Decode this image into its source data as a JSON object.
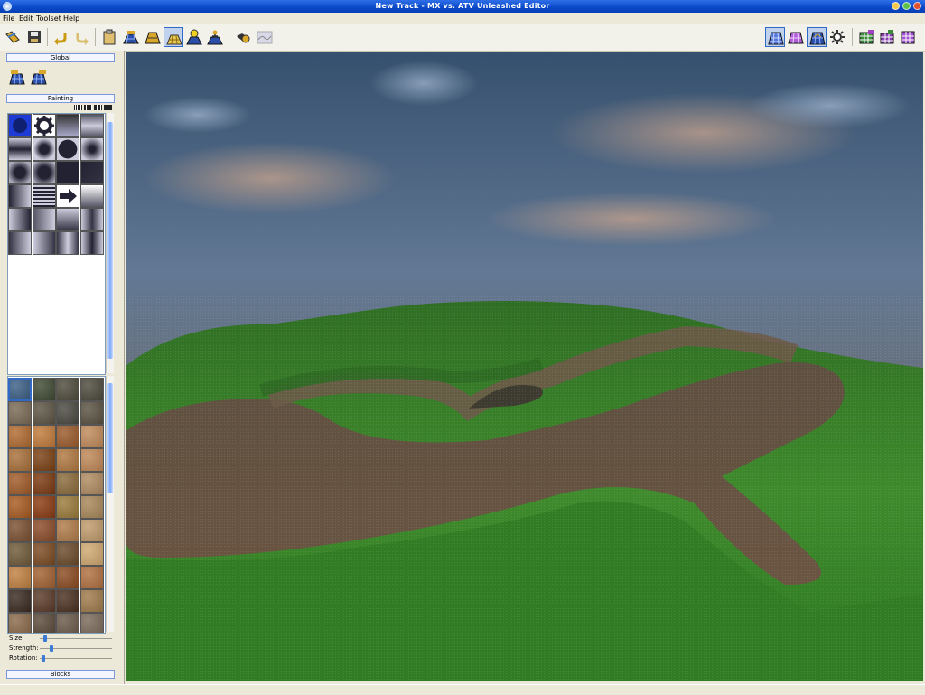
{
  "window": {
    "title": "New Track - MX vs. ATV Unleashed Editor"
  },
  "menu": {
    "file": "File",
    "edit": "Edit",
    "toolset": "Toolset",
    "help": "Help"
  },
  "panel": {
    "global_header": "Global",
    "painting_header": "Painting",
    "blocks_header": "Blocks",
    "size_label": "Size:",
    "strength_label": "Strength:",
    "rotation_label": "Rotation:",
    "size_value": 0.05,
    "strength_value": 0.14,
    "rotation_value": 0.02
  },
  "colors": {
    "titlebar": "#0a48c8",
    "accent": "#316ac5",
    "brush_selected": "#1e3bd6",
    "sky": "#5a7090",
    "grass": "#3f8a2c",
    "dirt": "#6b5542"
  },
  "icons": {
    "toolbar": [
      "open-icon",
      "save-icon",
      "undo-icon",
      "redo-icon",
      "clipboard-icon",
      "terrain-tool-icon",
      "terrain-fill-icon",
      "terrain-paint-icon",
      "terrain-light-icon",
      "terrain-person-icon",
      "camera-icon",
      "terrain-bumpy-icon",
      "wireframe-icon",
      "wireframe-purple-icon",
      "grid-view-icon",
      "sun-settings-icon",
      "grid-green-icon",
      "grid-purple-icon",
      "grid-mixed-icon"
    ]
  }
}
